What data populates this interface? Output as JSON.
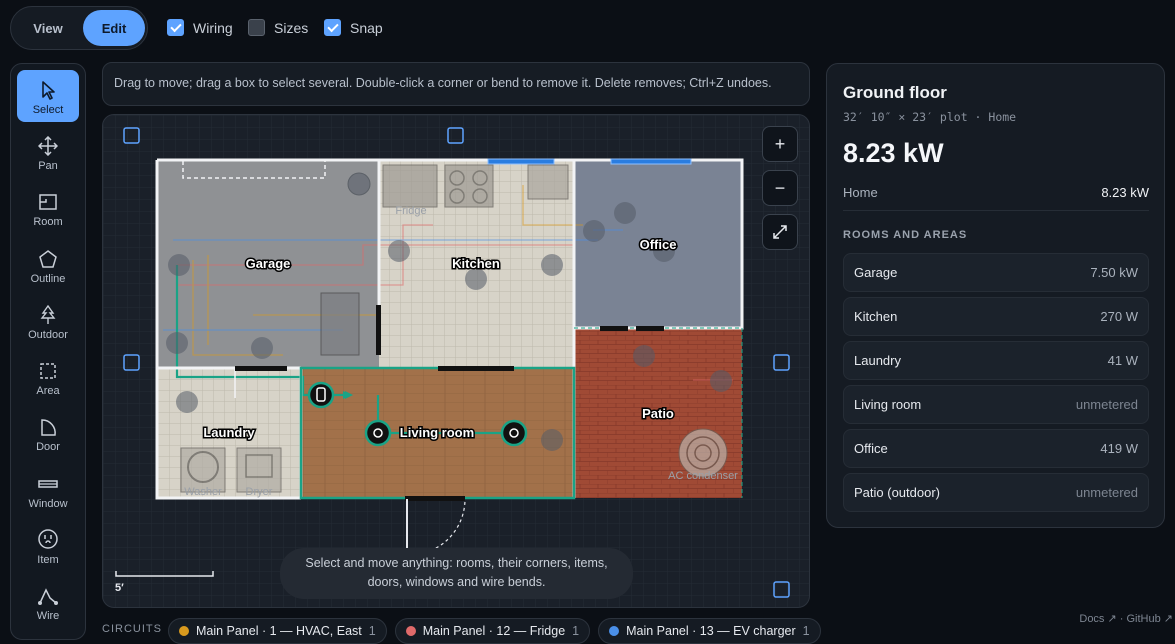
{
  "mode": {
    "view_label": "View",
    "edit_label": "Edit",
    "active": "Edit"
  },
  "toggles": [
    {
      "label": "Wiring",
      "checked": true
    },
    {
      "label": "Sizes",
      "checked": false
    },
    {
      "label": "Snap",
      "checked": true
    }
  ],
  "tools": [
    {
      "label": "Select",
      "icon": "cursor-icon",
      "active": true
    },
    {
      "label": "Pan",
      "icon": "move-icon"
    },
    {
      "label": "Room",
      "icon": "room-icon"
    },
    {
      "label": "Outline",
      "icon": "pentagon-icon"
    },
    {
      "label": "Outdoor",
      "icon": "tree-icon"
    },
    {
      "label": "Area",
      "icon": "dashed-square-icon"
    },
    {
      "label": "Door",
      "icon": "door-icon"
    },
    {
      "label": "Window",
      "icon": "window-icon"
    },
    {
      "label": "Item",
      "icon": "outlet-icon"
    },
    {
      "label": "Wire",
      "icon": "wire-icon"
    }
  ],
  "hint": "Drag to move; drag a box to select several. Double-click a corner or bend to remove it. Delete removes; Ctrl+Z undoes.",
  "plan": {
    "rooms": [
      "Garage",
      "Kitchen",
      "Office",
      "Laundry",
      "Living room",
      "Patio"
    ],
    "item_labels": {
      "fridge": "Fridge",
      "washer": "Washer",
      "dryer": "Dryer",
      "ac": "AC condenser"
    },
    "scale_label": "5′",
    "zoom_in": "+",
    "zoom_out": "−"
  },
  "toast": {
    "line1": "Select and move anything: rooms, their corners, items,",
    "line2": "doors, windows and wire bends."
  },
  "panel": {
    "title": "Ground floor",
    "subtitle": "32′ 10″ × 23′ plot · Home",
    "total": "8.23 kW",
    "home_label": "Home",
    "home_value": "8.23 kW",
    "section": "ROOMS AND AREAS",
    "rooms": [
      {
        "name": "Garage",
        "value": "7.50 kW"
      },
      {
        "name": "Kitchen",
        "value": "270 W"
      },
      {
        "name": "Laundry",
        "value": "41 W"
      },
      {
        "name": "Living room",
        "value": "unmetered"
      },
      {
        "name": "Office",
        "value": "419 W"
      },
      {
        "name": "Patio (outdoor)",
        "value": "unmetered"
      }
    ]
  },
  "links": "Docs ↗ · GitHub ↗",
  "circuits": {
    "label": "CIRCUITS",
    "items": [
      {
        "name": "Main Panel · 1 — HVAC, East",
        "count": "1",
        "color": "#d99a1e"
      },
      {
        "name": "Main Panel · 12 — Fridge",
        "count": "1",
        "color": "#e06a6a"
      },
      {
        "name": "Main Panel · 13 — EV charger",
        "count": "1",
        "color": "#4a8fe8"
      }
    ]
  }
}
